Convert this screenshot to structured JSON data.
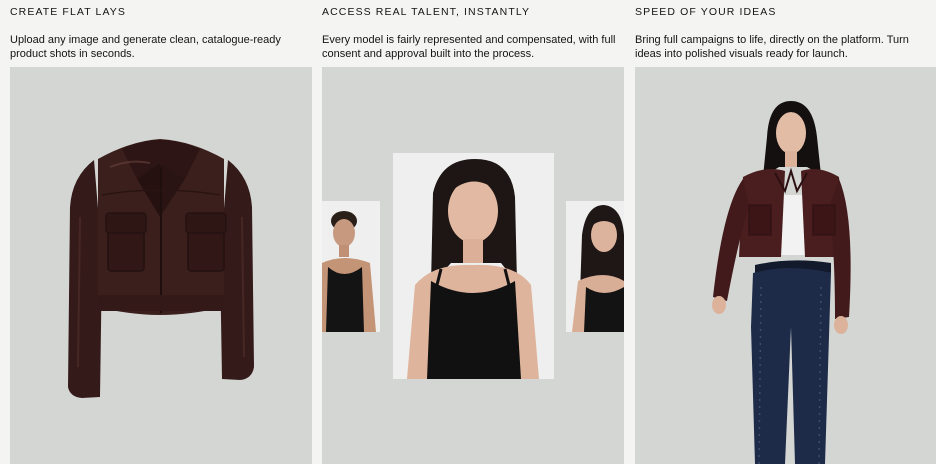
{
  "features": [
    {
      "eyebrow": "CREATE FLAT LAYS",
      "description": "Upload any image and generate clean, catalogue-ready product shots in seconds."
    },
    {
      "eyebrow": "ACCESS REAL TALENT, INSTANTLY",
      "description": "Every model is fairly represented and compensated, with full consent and approval built into the process."
    },
    {
      "eyebrow": "SPEED OF YOUR IDEAS",
      "description": "Bring full campaigns to life, directly on the platform. Turn ideas into polished visuals ready for launch."
    }
  ],
  "colors": {
    "page_background": "#f4f4f3",
    "panel_background": "#d4d6d4",
    "card_background": "#eeefee",
    "leather_jacket": "#3b1f1c",
    "burgundy_jacket": "#4a1d1e",
    "denim": "#1d2b48",
    "tank_top": "#111111"
  },
  "images": {
    "flat_lay": "leather-jacket-flat-lay",
    "talent_left": "male-model-black-tank-portrait",
    "talent_center": "female-model-black-tank-portrait",
    "talent_right": "female-model-bangs-black-tank-portrait",
    "campaign": "model-walking-burgundy-jacket-denim"
  }
}
